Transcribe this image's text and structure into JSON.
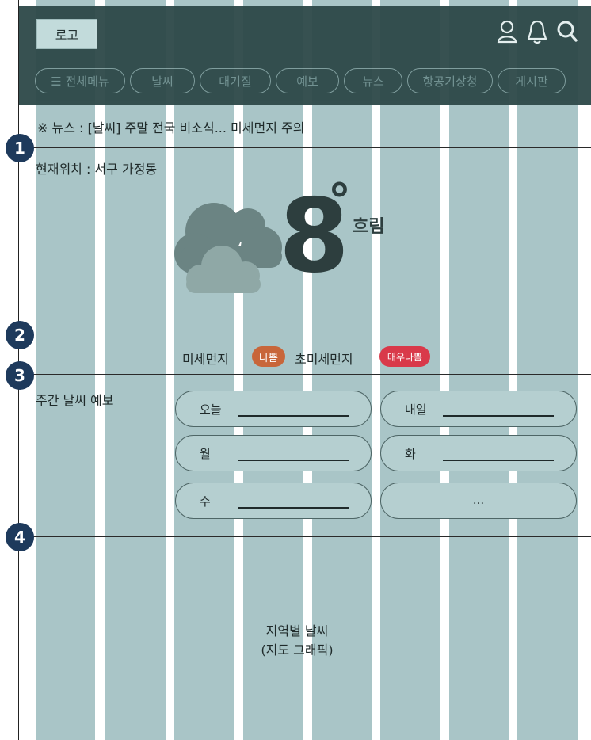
{
  "header": {
    "logo": "로고",
    "icons": [
      "user-icon",
      "bell-icon",
      "search-icon"
    ],
    "nav": [
      {
        "label": "☰ 전체메뉴"
      },
      {
        "label": "날씨"
      },
      {
        "label": "대기질"
      },
      {
        "label": "예보"
      },
      {
        "label": "뉴스"
      },
      {
        "label": "항공기상청"
      },
      {
        "label": "게시판"
      }
    ]
  },
  "news": "※ 뉴스 : [날씨] 주말 전국 비소식... 미세먼지 주의",
  "sections": [
    "1",
    "2",
    "3",
    "4"
  ],
  "current": {
    "location": "현재위치 : 서구 가정동",
    "temperature": "8",
    "degree": "°",
    "condition": "흐림",
    "icon": "cloud-icon"
  },
  "air": {
    "pm10_label": "미세먼지",
    "pm10_status": "나쁨",
    "pm25_label": "초미세먼지",
    "pm25_status": "매우나쁨",
    "colors": {
      "bad": "#c8663a",
      "very_bad": "#d9394a"
    }
  },
  "weekly": {
    "title": "주간 날씨 예보",
    "days": [
      {
        "label": "오늘"
      },
      {
        "label": "내일"
      },
      {
        "label": "월"
      },
      {
        "label": "화"
      },
      {
        "label": "수"
      },
      {
        "label": "..."
      }
    ]
  },
  "map": {
    "line1": "지역별 날씨",
    "line2": "(지도 그래픽)"
  }
}
